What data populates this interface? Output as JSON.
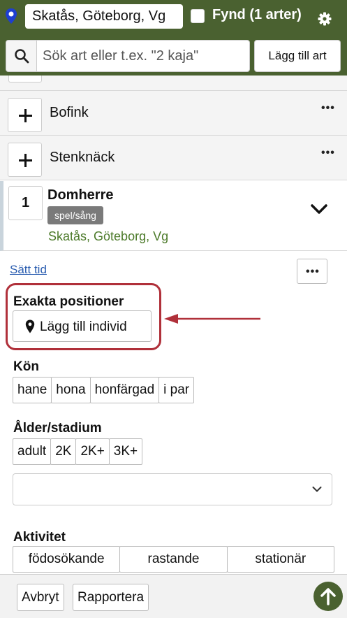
{
  "colors": {
    "brand_green": "#4a6130",
    "location_green": "#4c7a2a",
    "annotation_red": "#b0303a",
    "link_blue": "#2a5db0"
  },
  "header": {
    "location": "Skatås, Göteborg, Vg",
    "fynd_label": "Fynd (1 arter)",
    "fynd_checked": false
  },
  "search": {
    "placeholder": "Sök art eller t.ex. \"2 kaja\"",
    "value": "",
    "add_button": "Lägg till art"
  },
  "species_list": [
    {
      "name": "Bofink",
      "more": "•••"
    },
    {
      "name": "Stenknäck",
      "more": "•••"
    }
  ],
  "expanded": {
    "count": "1",
    "name": "Domherre",
    "tag": "spel/sång",
    "location": "Skatås, Göteborg, Vg",
    "set_time": "Sätt tid",
    "more": "•••",
    "exact_positions_label": "Exakta positioner",
    "add_individual": "Lägg till individ",
    "sex_label": "Kön",
    "sex_options": [
      "hane",
      "hona",
      "honfärgad",
      "i par"
    ],
    "age_label": "Ålder/stadium",
    "age_options": [
      "adult",
      "2K",
      "2K+",
      "3K+"
    ],
    "age_select_value": "",
    "activity_label": "Aktivitet",
    "activity_options": [
      "födosökande",
      "rastande",
      "stationär"
    ]
  },
  "footer": {
    "cancel": "Avbryt",
    "report": "Rapportera"
  }
}
